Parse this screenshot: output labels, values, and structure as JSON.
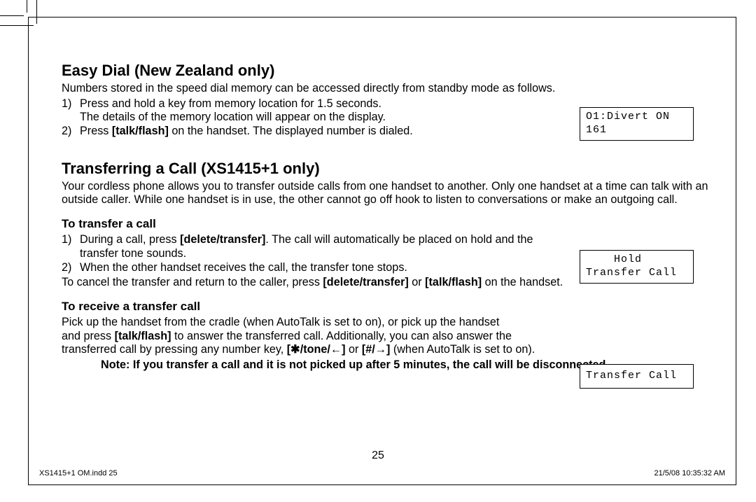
{
  "section1": {
    "heading": "Easy Dial (New Zealand only)",
    "intro": "Numbers stored in the speed dial memory can be accessed directly from standby mode as follows.",
    "step1a": "Press and hold a key from memory location for 1.5 seconds.",
    "step1b": "The details of the memory location will appear on the display.",
    "step2_pre": "Press ",
    "step2_bold": "[talk/flash]",
    "step2_post": " on the handset. The displayed number is dialed."
  },
  "lcd1": "O1:Divert ON\n161",
  "section2": {
    "heading": "Transferring a Call (XS1415+1 only)",
    "intro": "Your cordless phone allows you to transfer outside calls from one handset to another. Only one handset at a time can talk with an outside caller. While one handset is in use, the other cannot go off hook to listen to conversations or make an outgoing call."
  },
  "transfer": {
    "subheading": "To transfer a call",
    "s1_pre": "During a call, press ",
    "s1_bold": "[delete/transfer]",
    "s1_post": ". The call will automatically be placed on hold and the",
    "s1_line2": "transfer tone sounds.",
    "s2": "When the other handset receives the call, the transfer tone stops.",
    "cancel_pre": "To cancel the transfer and return to the caller, press ",
    "cancel_b1": "[delete/transfer]",
    "cancel_mid": " or ",
    "cancel_b2": "[talk/flash]",
    "cancel_post": " on the handset."
  },
  "lcd2": "    Hold\nTransfer Call",
  "receive": {
    "subheading": "To receive a transfer call",
    "line1": "Pick up the handset from the cradle (when AutoTalk is set to on), or pick up the handset",
    "line2_pre": "and press ",
    "line2_b": "[talk/flash]",
    "line2_post": " to answer the transferred call. Additionally, you can also answer the",
    "line3_pre": "transferred call by pressing any number key, ",
    "line3_b1": "[✱/tone/←]",
    "line3_mid": " or ",
    "line3_b2": "[#/→]",
    "line3_post": " (when AutoTalk is set to on)."
  },
  "lcd3": "Transfer Call",
  "note": "Note: If you transfer a call and it is not picked up after 5 minutes, the call will be disconnected.",
  "pagenum": "25",
  "footer_left": "XS1415+1 OM.indd   25",
  "footer_right": "21/5/08   10:35:32 AM"
}
